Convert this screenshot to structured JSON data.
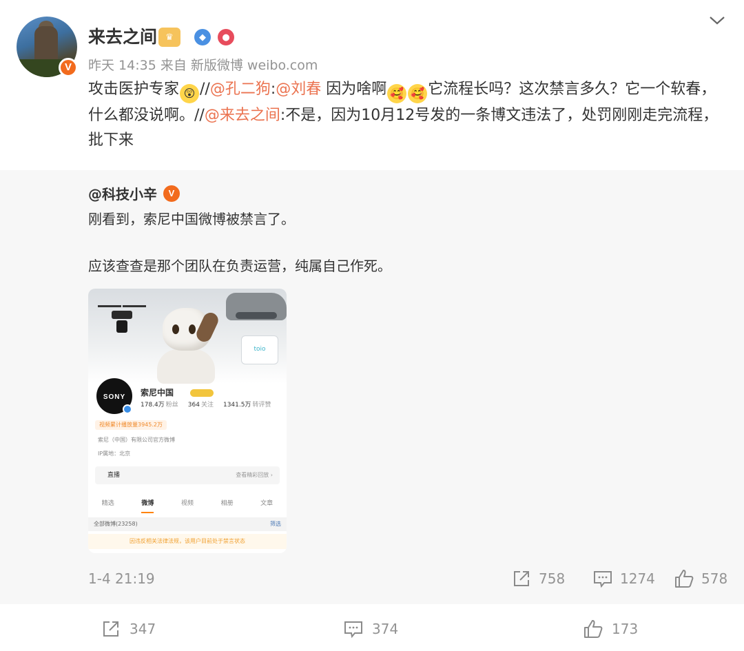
{
  "post": {
    "username": "来去之间",
    "meta": "昨天 14:35  来自 新版微博 weibo.com",
    "text": {
      "p1": "攻击医护专家",
      "sep1": "//",
      "m1": "@孔二狗",
      "colon1": ":",
      "m2": "@刘春",
      "p2": " 因为啥啊",
      "p3": "它流程长吗？这次禁言多久？它一个软春，什么都没说啊。//",
      "m3": "@来去之间",
      "p4": ":不是，因为10月12号发的一条博文违法了，处罚刚刚走完流程，批下来"
    }
  },
  "retweet": {
    "user": "@科技小辛",
    "line1": "刚看到，索尼中国微博被禁言了。",
    "line2": "应该查查是那个团队在负责运营，纯属自己作死。",
    "time": "1-4 21:19",
    "reposts": "758",
    "comments": "1274",
    "likes": "578",
    "screenshot": {
      "toio": "toio",
      "brand": "SONY",
      "account": "索尼中国",
      "stats": [
        {
          "value": "178.4万",
          "label": "粉丝"
        },
        {
          "value": "364",
          "label": "关注"
        },
        {
          "value": "1341.5万",
          "label": "转评赞"
        }
      ],
      "views": "视频累计播放量3945.2万",
      "company": "索尼（中国）有限公司官方微博",
      "ip": "IP属地：北京",
      "live": "直播",
      "live_more": "查看精彩回放 ›",
      "tabs": [
        "精选",
        "微博",
        "视频",
        "相册",
        "文章"
      ],
      "all_posts": "全部微博(23258)",
      "filter": "筛选",
      "ban": "因违反相关法律法规，该用户目前处于禁言状态"
    }
  },
  "footer": {
    "reposts": "347",
    "comments": "374",
    "likes": "173"
  },
  "colors": {
    "mention": "#eb7350",
    "meta": "#939393",
    "verified": "#f26b1d",
    "retweet_bg": "#f7f7f7"
  }
}
